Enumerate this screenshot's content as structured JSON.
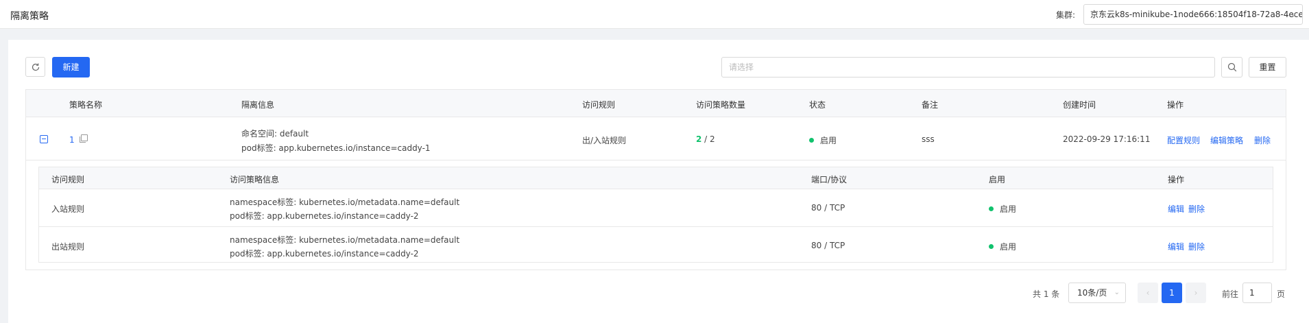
{
  "header": {
    "title": "隔离策略",
    "cluster_label": "集群:",
    "cluster_value": "京东云k8s-minikube-1node666:18504f18-72a8-4ece"
  },
  "toolbar": {
    "new_label": "新建",
    "search_placeholder": "请选择",
    "reset_label": "重置"
  },
  "table": {
    "columns": [
      "策略名称",
      "隔离信息",
      "访问规则",
      "访问策略数量",
      "状态",
      "备注",
      "创建时间",
      "操作"
    ],
    "rows": [
      {
        "name": "1",
        "isolation_line1": "命名空间: default",
        "isolation_line2": "pod标签: app.kubernetes.io/instance=caddy-1",
        "access_rule": "出/入站规则",
        "policy_count_active": "2",
        "policy_count_sep": " / ",
        "policy_count_total": "2",
        "status": "启用",
        "remark": "sss",
        "created": "2022-09-29 17:16:11",
        "actions": [
          "配置规则",
          "编辑策略",
          "删除"
        ]
      }
    ]
  },
  "sub_table": {
    "columns": [
      "访问规则",
      "访问策略信息",
      "端口/协议",
      "启用",
      "操作"
    ],
    "rows": [
      {
        "rule": "入站规则",
        "info_line1": "namespace标签: kubernetes.io/metadata.name=default",
        "info_line2": "pod标签: app.kubernetes.io/instance=caddy-2",
        "port": "80 / TCP",
        "enabled": "启用",
        "actions": [
          "编辑",
          "删除"
        ]
      },
      {
        "rule": "出站规则",
        "info_line1": "namespace标签: kubernetes.io/metadata.name=default",
        "info_line2": "pod标签: app.kubernetes.io/instance=caddy-2",
        "port": "80 / TCP",
        "enabled": "启用",
        "actions": [
          "编辑",
          "删除"
        ]
      }
    ]
  },
  "pagination": {
    "total_text": "共 1 条",
    "page_size": "10条/页",
    "current_page": "1",
    "goto_label": "前往",
    "goto_value": "1",
    "page_suffix": "页"
  },
  "colors": {
    "primary": "#2468f2",
    "success": "#11c26d"
  }
}
